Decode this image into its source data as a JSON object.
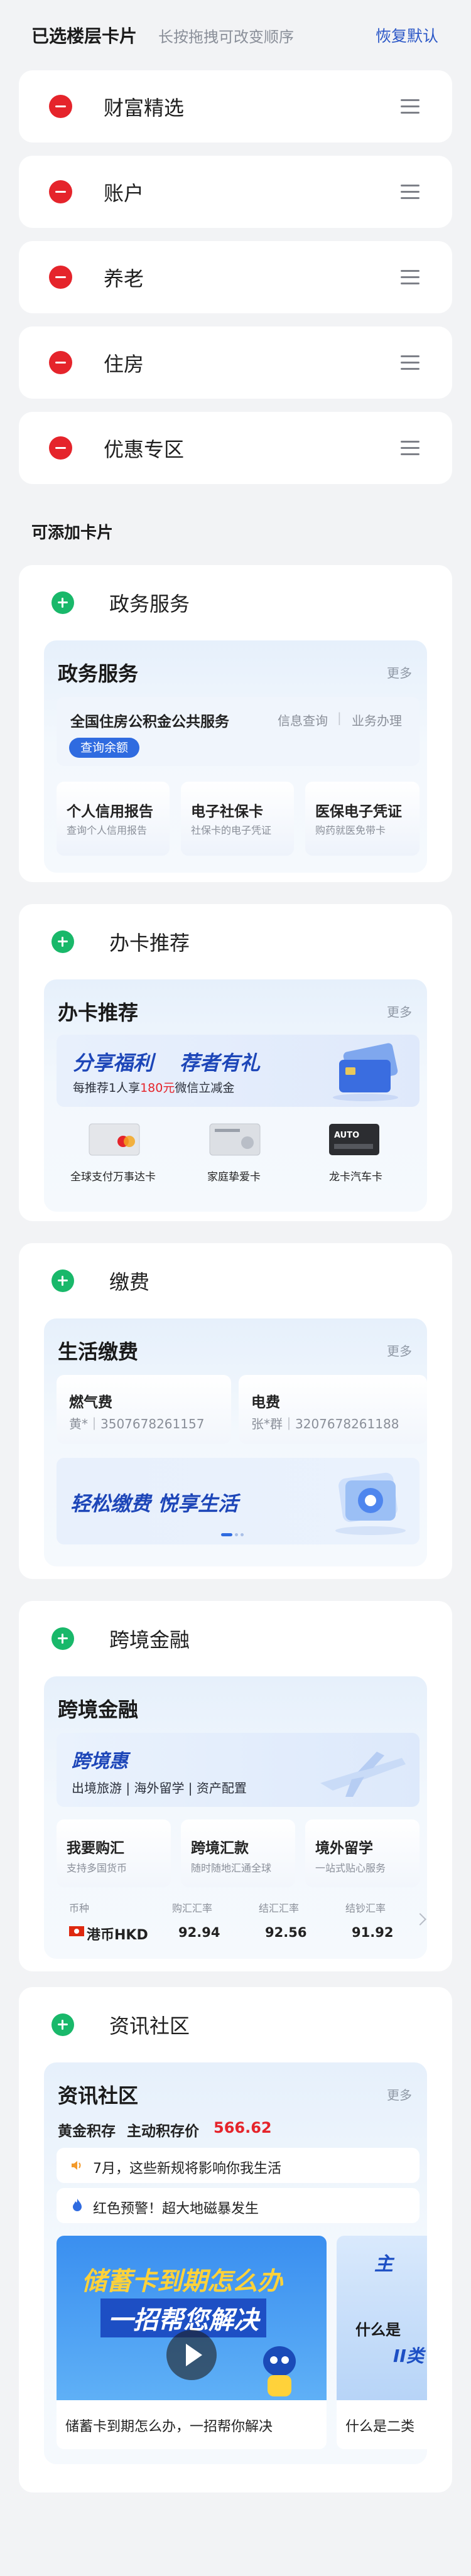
{
  "header": {
    "title": "已选楼层卡片",
    "subtitle": "长按拖拽可改变顺序",
    "reset": "恢复默认"
  },
  "selected": [
    {
      "label": "财富精选"
    },
    {
      "label": "账户"
    },
    {
      "label": "养老"
    },
    {
      "label": "住房"
    },
    {
      "label": "优惠专区"
    }
  ],
  "addable_title": "可添加卡片",
  "gov": {
    "label": "政务服务",
    "title": "政务服务",
    "more": "更多",
    "fund": {
      "title": "全国住房公积金公共服务",
      "link1": "信息查询",
      "sep": "|",
      "link2": "业务办理",
      "pill": "查询余额"
    },
    "tiles": [
      {
        "t": "个人信用报告",
        "s": "查询个人信用报告"
      },
      {
        "t": "电子社保卡",
        "s": "社保卡的电子凭证"
      },
      {
        "t": "医保电子凭证",
        "s": "购药就医免带卡"
      }
    ]
  },
  "cards": {
    "label": "办卡推荐",
    "title": "办卡推荐",
    "more": "更多",
    "banner": {
      "h1": "分享福利",
      "h2": "荐者有礼",
      "sub_pre": "每推荐1人享",
      "sub_hl": "180元",
      "sub_post": "微信立减金"
    },
    "items": [
      {
        "label": "全球支付万事达卡"
      },
      {
        "label": "家庭挚爱卡"
      },
      {
        "label": "龙卡汽车卡"
      }
    ],
    "card3_text": "AUTO"
  },
  "pay": {
    "label": "缴费",
    "title": "生活缴费",
    "more": "更多",
    "gas": {
      "t": "燃气费",
      "s": "黄*｜3507678261157"
    },
    "elec": {
      "t": "电费",
      "s": "张*群｜3207678261188"
    },
    "banner": "轻松缴费  悦享生活"
  },
  "cross": {
    "label": "跨境金融",
    "title": "跨境金融",
    "banner": {
      "h": "跨境惠",
      "s": "出境旅游 | 海外留学 | 资产配置"
    },
    "tiles": [
      {
        "t": "我要购汇",
        "s": "支持多国货币"
      },
      {
        "t": "跨境汇款",
        "s": "随时随地汇通全球"
      },
      {
        "t": "境外留学",
        "s": "一站式贴心服务"
      }
    ],
    "fx_head": {
      "c1": "币种",
      "c2": "购汇汇率",
      "c3": "结汇汇率",
      "c4": "结钞汇率"
    },
    "fx_row": {
      "cur": "港币HKD",
      "v1": "92.94",
      "v2": "92.56",
      "v3": "91.92"
    }
  },
  "news": {
    "label": "资讯社区",
    "title": "资讯社区",
    "more": "更多",
    "gold": {
      "l1": "黄金积存",
      "l2": "主动积存价",
      "price": "566.62"
    },
    "items": [
      {
        "t": "7月，这些新规将影响你我生活"
      },
      {
        "t": "红色预警！超大地磁暴发生"
      }
    ],
    "video1": {
      "line1": "储蓄卡到期怎么办",
      "line2": "一招帮您解决",
      "caption": "储蓄卡到期怎么办，一招帮你解决"
    },
    "video2": {
      "line1": "主",
      "line2": "什么是",
      "line3": "II类",
      "caption": "什么是二类"
    }
  },
  "colors": {
    "accent": "#2b57c7",
    "remove": "#e5242b",
    "add": "#19b86a",
    "price": "#e5242b"
  }
}
